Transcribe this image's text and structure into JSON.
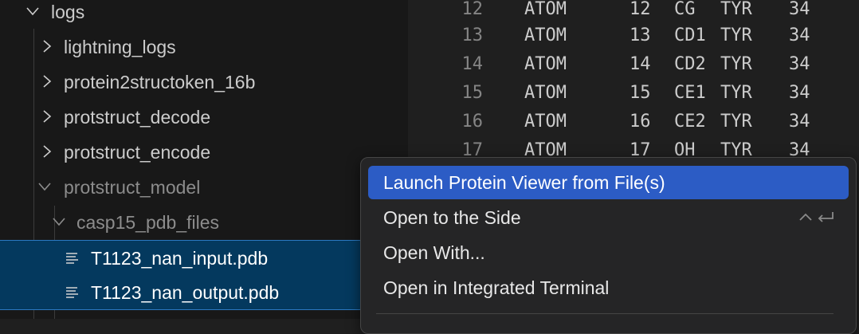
{
  "explorer": {
    "items": [
      {
        "label": "logs",
        "kind": "folder-open"
      },
      {
        "label": "lightning_logs",
        "kind": "folder-closed"
      },
      {
        "label": "protein2structoken_16b",
        "kind": "folder-closed"
      },
      {
        "label": "protstruct_decode",
        "kind": "folder-closed"
      },
      {
        "label": "protstruct_encode",
        "kind": "folder-closed"
      },
      {
        "label": "protstruct_model",
        "kind": "folder-open"
      },
      {
        "label": "casp15_pdb_files",
        "kind": "folder-open"
      },
      {
        "label": "T1123_nan_input.pdb",
        "kind": "file",
        "selected": true
      },
      {
        "label": "T1123_nan_output.pdb",
        "kind": "file",
        "selected": true
      }
    ]
  },
  "editor": {
    "lines": [
      {
        "num": "12",
        "rec": "ATOM",
        "serial": "12",
        "atom": "CG",
        "res": "TYR",
        "seq": "34"
      },
      {
        "num": "13",
        "rec": "ATOM",
        "serial": "13",
        "atom": "CD1",
        "res": "TYR",
        "seq": "34"
      },
      {
        "num": "14",
        "rec": "ATOM",
        "serial": "14",
        "atom": "CD2",
        "res": "TYR",
        "seq": "34"
      },
      {
        "num": "15",
        "rec": "ATOM",
        "serial": "15",
        "atom": "CE1",
        "res": "TYR",
        "seq": "34"
      },
      {
        "num": "16",
        "rec": "ATOM",
        "serial": "16",
        "atom": "CE2",
        "res": "TYR",
        "seq": "34"
      },
      {
        "num": "17",
        "rec": "ATOM",
        "serial": "17",
        "atom": "OH",
        "res": "TYR",
        "seq": "34"
      }
    ]
  },
  "context_menu": {
    "items": [
      {
        "label": "Launch Protein Viewer from File(s)",
        "active": true
      },
      {
        "label": "Open to the Side",
        "shortcut_icons": [
          "control-key-icon",
          "return-key-icon"
        ]
      },
      {
        "label": "Open With..."
      },
      {
        "label": "Open in Integrated Terminal"
      }
    ]
  },
  "colors": {
    "sidebar_bg": "#181818",
    "editor_bg": "#1f1f1f",
    "selection_bg": "#04395e",
    "selection_border": "#2b79c2",
    "menu_bg": "#252526",
    "menu_highlight": "#2c5cc5"
  }
}
